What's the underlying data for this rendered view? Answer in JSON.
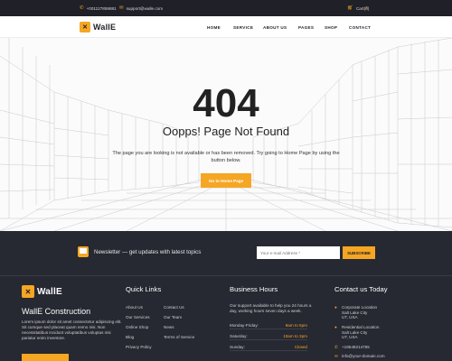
{
  "topbar": {
    "phone": "+001127859881",
    "email": "support@walle.com",
    "cart": "Cart(0)",
    "phone_icon": "phone-icon",
    "email_icon": "envelope-icon",
    "cart_icon": "cart-icon",
    "search_icon": "search-icon"
  },
  "header": {
    "logo": "WallE",
    "nav": [
      "HOME",
      "SERVICE",
      "ABOUT US",
      "PAGES",
      "SHOP",
      "CONTACT"
    ]
  },
  "hero": {
    "code": "404",
    "title": "Oopps! Page Not Found",
    "message": "The page you are looking is not available or has been removed. Try going to Home Page by using the button below.",
    "button": "Go to Home Page"
  },
  "newsletter": {
    "text": "Newsletter — get updates with latest topics",
    "placeholder": "Your e-mail Address *",
    "button": "SUBSCRIBE"
  },
  "footer": {
    "logo": "WallE",
    "brand": "WallE Construction",
    "about": "Lorem ipsum dolor sit amet consectetur adipiscing elit. Sit cumque sed placeat quam nemo nisi. Non necessitatibus incidunt voluptatibus voluptas nisi pariatur enim inventore.",
    "quick_links_title": "Quick Links",
    "links_left": [
      "About Us",
      "Our Services",
      "Online Shop",
      "Blog",
      "Privacy Policy"
    ],
    "links_right": [
      "Contact Us",
      "Our Team",
      "News",
      "Terms of Service"
    ],
    "hours_title": "Business Hours",
    "hours_text": "Our support available to help you 24 hours a day, working hours seven days a week.",
    "hours": [
      {
        "day": "Monday-Friday:",
        "time": "9am to 5pm"
      },
      {
        "day": "Saturday:",
        "time": "10am to 3pm"
      },
      {
        "day": "Sunday:",
        "time": "Closed"
      }
    ],
    "contact_title": "Contact us Today",
    "contact": [
      {
        "label": "Corporate Location",
        "line1": "Salt Lake City",
        "line2": "UT, USA"
      },
      {
        "label": "Residential Location",
        "line1": "Salt Lake City",
        "line2": "UT, USA"
      },
      {
        "label": "+18548214785",
        "line1": "",
        "line2": ""
      },
      {
        "label": "info@your-domain.com",
        "line1": "",
        "line2": ""
      }
    ]
  },
  "colors": {
    "accent": "#f5a623",
    "dark": "#262832",
    "topbar": "#1f2028"
  }
}
